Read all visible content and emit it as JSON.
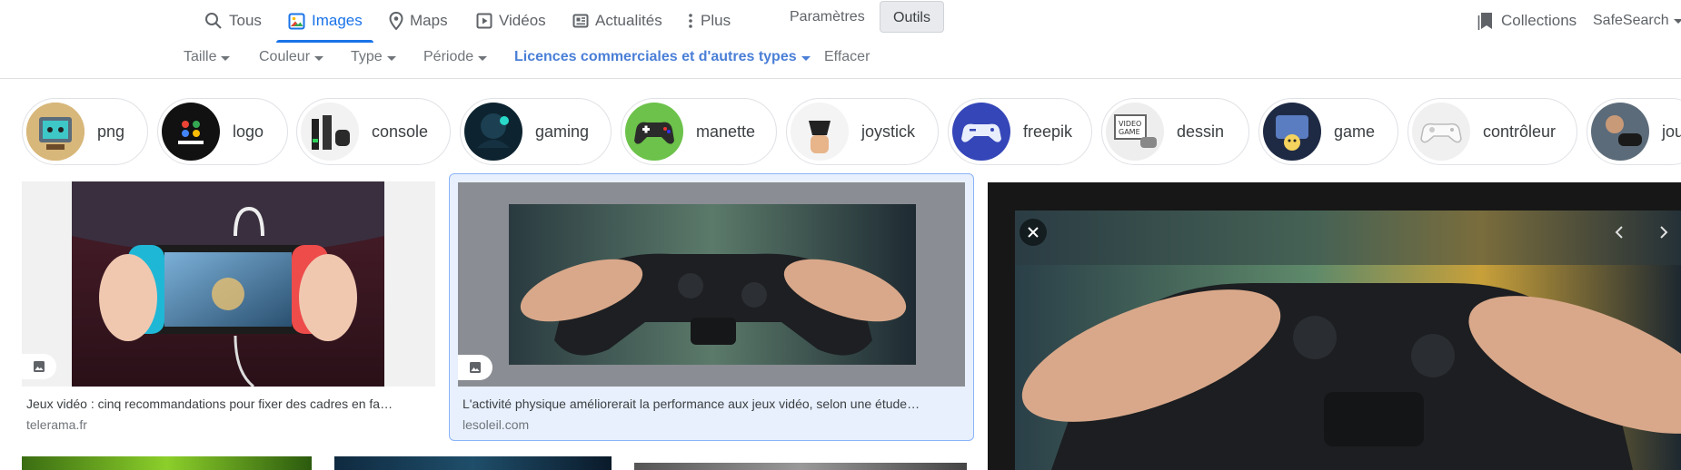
{
  "tabs": [
    {
      "label": "Tous",
      "icon": "search-icon"
    },
    {
      "label": "Images",
      "icon": "images-icon",
      "active": true
    },
    {
      "label": "Maps",
      "icon": "map-pin-icon"
    },
    {
      "label": "Vidéos",
      "icon": "video-icon"
    },
    {
      "label": "Actualités",
      "icon": "news-icon"
    },
    {
      "label": "Plus",
      "icon": "more-vert-icon"
    }
  ],
  "toolbar": {
    "settings_label": "Paramètres",
    "tools_label": "Outils",
    "collections_label": "Collections",
    "safesearch_label": "SafeSearch"
  },
  "filters": [
    {
      "label": "Taille"
    },
    {
      "label": "Couleur"
    },
    {
      "label": "Type"
    },
    {
      "label": "Période"
    },
    {
      "label": "Licences commerciales et d'autres types",
      "active": true
    },
    {
      "label": "Effacer"
    }
  ],
  "chips": [
    {
      "label": "png"
    },
    {
      "label": "logo"
    },
    {
      "label": "console"
    },
    {
      "label": "gaming"
    },
    {
      "label": "manette"
    },
    {
      "label": "joystick"
    },
    {
      "label": "freepik"
    },
    {
      "label": "dessin"
    },
    {
      "label": "game"
    },
    {
      "label": "contrôleur"
    },
    {
      "label": "jou"
    }
  ],
  "results": [
    {
      "caption": "Jeux vidéo : cinq recommandations pour fixer des cadres en fa…",
      "source": "telerama.fr"
    },
    {
      "caption": "L'activité physique améliorerait la performance aux jeux vidéo, selon une étude…",
      "source": "lesoleil.com",
      "selected": true
    }
  ],
  "colors": {
    "accent": "#1a73e8",
    "active_filter": "#4a7fd7",
    "selected_card_bg": "#e8f0fe"
  }
}
